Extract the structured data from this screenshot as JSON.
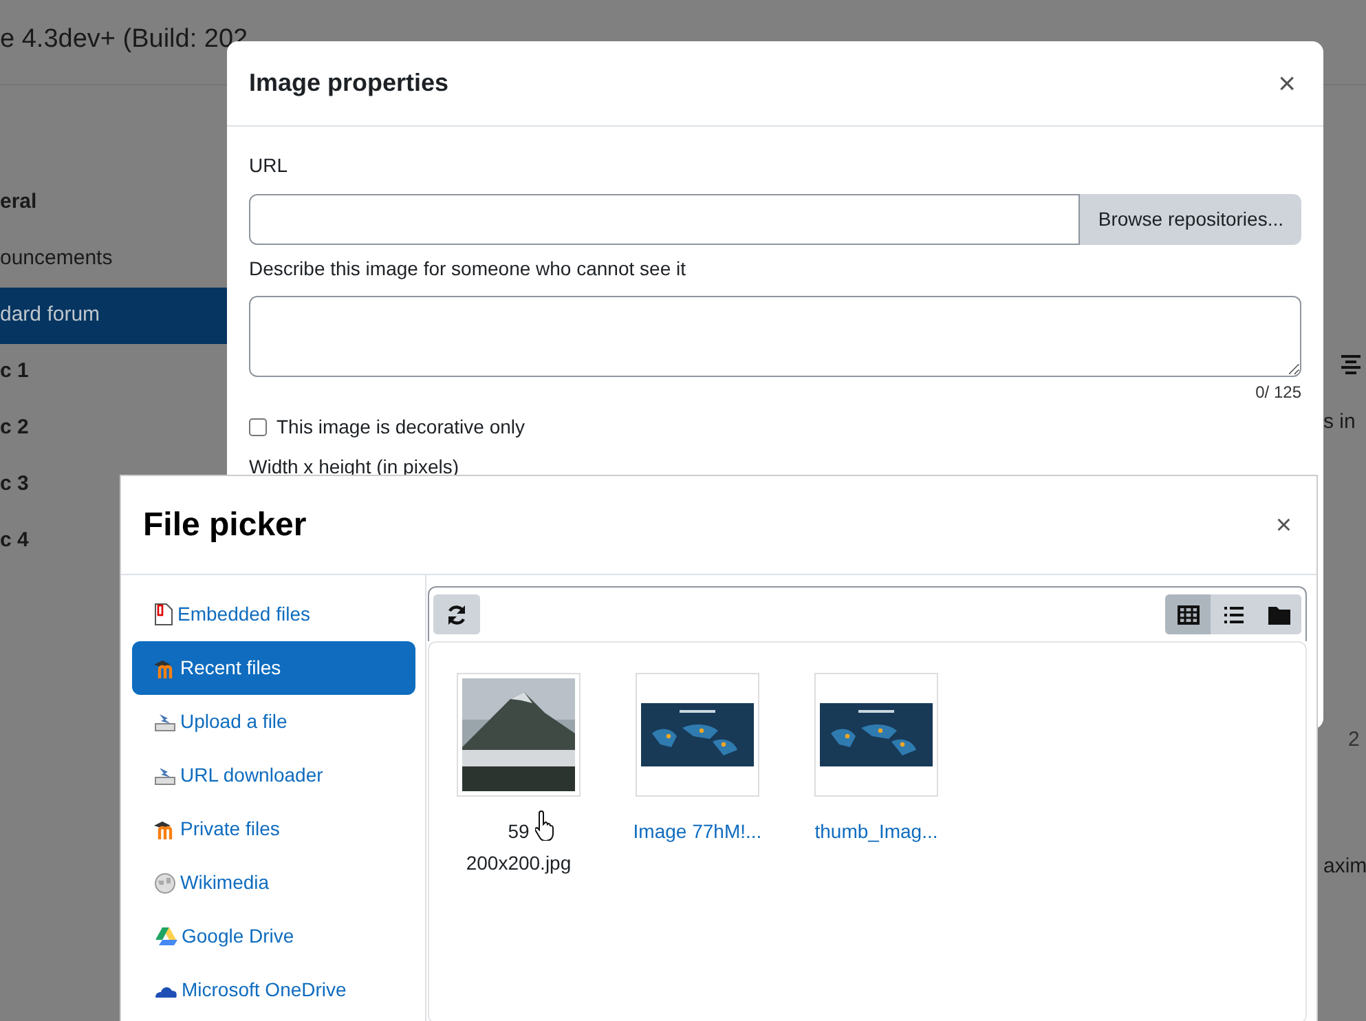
{
  "page": {
    "site_title": "e 4.3dev+ (Build: 202",
    "course_index": [
      {
        "label": "eral",
        "kind": "section",
        "selected": false
      },
      {
        "label": "ouncements",
        "kind": "activity",
        "selected": false
      },
      {
        "label": "dard forum",
        "kind": "activity",
        "selected": true
      },
      {
        "label": "c 1",
        "kind": "section",
        "selected": false
      },
      {
        "label": "c 2",
        "kind": "section",
        "selected": false
      },
      {
        "label": "c 3",
        "kind": "section",
        "selected": false
      },
      {
        "label": "c 4",
        "kind": "section",
        "selected": false
      }
    ],
    "edge_texts": [
      "s in",
      "2",
      "axim"
    ]
  },
  "image_properties": {
    "title": "Image properties",
    "close": "×",
    "url_label": "URL",
    "browse_button": "Browse repositories...",
    "alt_label": "Describe this image for someone who cannot see it",
    "alt_counter": "0/ 125",
    "decorative": {
      "label": "This image is decorative only",
      "checked": false
    },
    "size_label": "Width x height (in pixels)"
  },
  "file_picker": {
    "title": "File picker",
    "close": "×",
    "repositories": [
      {
        "label": "Embedded files",
        "kind": "document",
        "selected": false
      },
      {
        "label": "Recent files",
        "kind": "moodle",
        "selected": true
      },
      {
        "label": "Upload a file",
        "kind": "upload",
        "selected": false
      },
      {
        "label": "URL downloader",
        "kind": "upload",
        "selected": false
      },
      {
        "label": "Private files",
        "kind": "moodle",
        "selected": false
      },
      {
        "label": "Wikimedia",
        "kind": "globe",
        "selected": false
      },
      {
        "label": "Google Drive",
        "kind": "drive",
        "selected": false
      },
      {
        "label": "Microsoft OneDrive",
        "kind": "cloud",
        "selected": false
      }
    ],
    "views": [
      {
        "kind": "grid",
        "selected": true
      },
      {
        "kind": "list",
        "selected": false
      },
      {
        "kind": "tree",
        "selected": false
      }
    ],
    "files": [
      {
        "name_lines": [
          "59",
          "200x200.jpg"
        ],
        "hovered": true
      },
      {
        "name_lines": [
          "Image 77hM!..."
        ],
        "hovered": false
      },
      {
        "name_lines": [
          "thumb_Imag..."
        ],
        "hovered": false
      }
    ]
  }
}
